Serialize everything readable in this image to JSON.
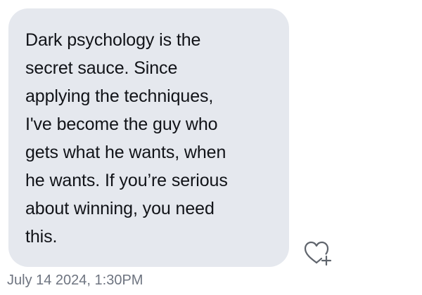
{
  "message": {
    "text": "Dark psychology is the\nsecret sauce. Since\napplying the techniques,\nI've become the guy who\ngets what he wants, when\nhe wants. If you’re serious\nabout winning, you need\nthis.",
    "timestamp": "July 14 2024, 1:30PM",
    "bubble_color": "#e5e8ee"
  },
  "actions": {
    "react_icon": "heart-plus-icon"
  }
}
